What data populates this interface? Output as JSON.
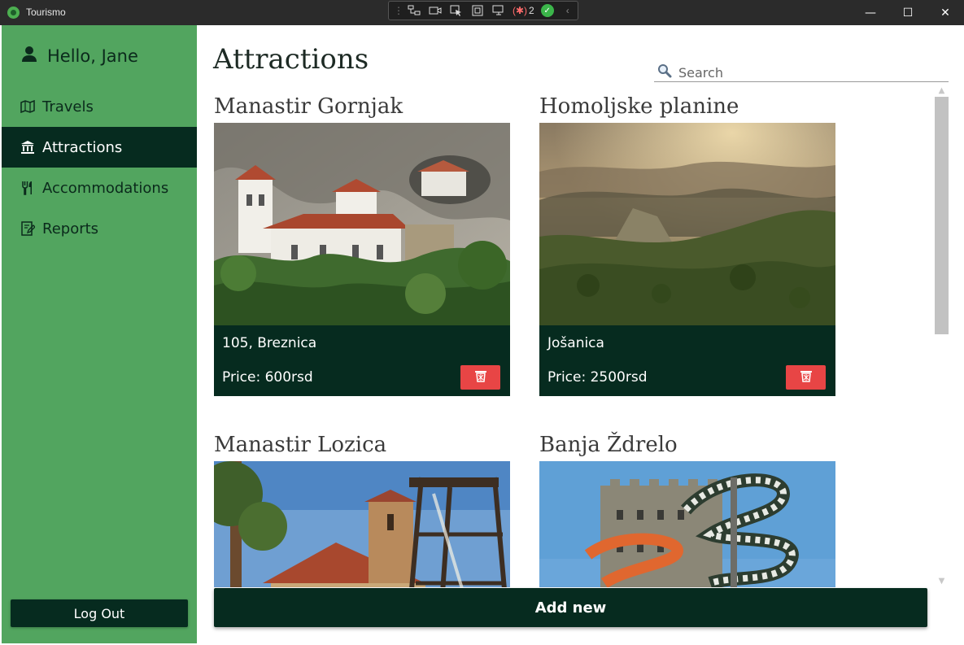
{
  "window": {
    "title": "Tourismo",
    "debug_badge_count": "2",
    "controls": [
      "—",
      "☐",
      "✕"
    ]
  },
  "sidebar": {
    "greeting": "Hello, Jane",
    "items": [
      {
        "label": "Travels",
        "icon": "map-icon",
        "active": false
      },
      {
        "label": "Attractions",
        "icon": "museum-icon",
        "active": true
      },
      {
        "label": "Accommodations",
        "icon": "cutlery-icon",
        "active": false
      },
      {
        "label": "Reports",
        "icon": "report-icon",
        "active": false
      }
    ],
    "logout_label": "Log Out"
  },
  "main": {
    "title": "Attractions",
    "search": {
      "placeholder": "Search",
      "value": ""
    },
    "add_new_label": "Add new"
  },
  "attractions": [
    {
      "name": "Manastir Gornjak",
      "address": "105, Breznica",
      "price": "Price: 600rsd",
      "image": "monastery-cliff-photo"
    },
    {
      "name": "Homoljske planine",
      "address": "Jošanica",
      "price": "Price: 2500rsd",
      "image": "mountain-sunset-photo"
    },
    {
      "name": "Manastir Lozica",
      "address": "",
      "price": "",
      "image": "monastery-forest-photo"
    },
    {
      "name": "Banja Ždrelo",
      "address": "",
      "price": "",
      "image": "waterpark-castle-photo"
    }
  ],
  "colors": {
    "sidebar_bg": "#52a55f",
    "dark_green": "#062b1f",
    "delete_red": "#e84545",
    "titlebar_bg": "#2b2b2b"
  }
}
